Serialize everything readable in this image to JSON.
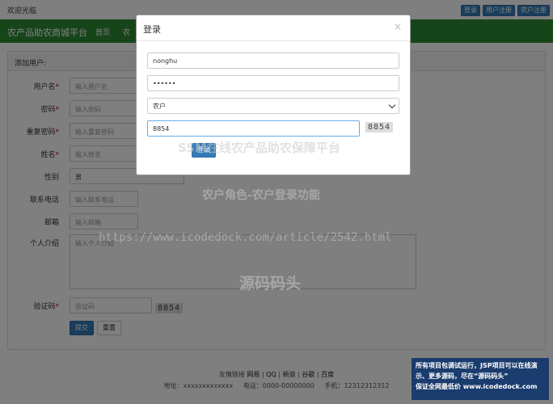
{
  "topbar": {
    "welcome": "欢迎光临",
    "buttons": [
      "登录",
      "用户注册",
      "农户注册"
    ]
  },
  "navbar": {
    "brand": "农产品助农商城平台",
    "links": [
      "首页",
      "农"
    ]
  },
  "panel": {
    "title": "添加用户:"
  },
  "form": {
    "username_label": "用户名",
    "username_placeholder": "输入用户名",
    "password_label": "密码",
    "password_placeholder": "输入密码",
    "confirm_label": "重复密码",
    "confirm_placeholder": "输入重复密码",
    "name_label": "姓名",
    "name_placeholder": "输入姓名",
    "gender_label": "性别",
    "gender_value": "男",
    "phone_label": "联系电话",
    "phone_placeholder": "输入联系电话",
    "email_label": "邮箱",
    "email_placeholder": "输入邮箱",
    "intro_label": "个人介绍",
    "intro_placeholder": "输入个人介绍",
    "captcha_label": "验证码",
    "captcha_placeholder": "验证码",
    "captcha_image": "8854",
    "submit_label": "提交",
    "reset_label": "重置",
    "required_mark": "*"
  },
  "footer": {
    "links_label": "友情链接",
    "links": [
      "网易",
      "QQ",
      "新浪",
      "谷歌",
      "百度"
    ],
    "separator": "|",
    "address": "地址：xxxxxxxxxxxxx",
    "phone": "电话：0000-00000000",
    "mobile": "手机：12312312312"
  },
  "modal": {
    "title": "登录",
    "close": "×",
    "username_value": "nonghu",
    "password_value": "••••••",
    "role_value": "农户",
    "captcha_value": "8854",
    "captcha_image": "8854",
    "login_label": "登录"
  },
  "watermark": {
    "line1": "SSM在线农产品助农保障平台",
    "line2": "农户角色-农户登录功能",
    "url": "https://www.icodedock.com/article/2542.html",
    "line3": "源码码头"
  },
  "ad": {
    "line1": "所有项目包调试运行，JSP项目可以在线演",
    "line2": "示、更多源码，尽在“源码码头”",
    "line3": "保证全网最低价 www.icodedock.com"
  },
  "colors": {
    "nav_green": "#2e8b34",
    "primary_blue": "#337ab7",
    "ad_bg": "#1a3c6e"
  }
}
